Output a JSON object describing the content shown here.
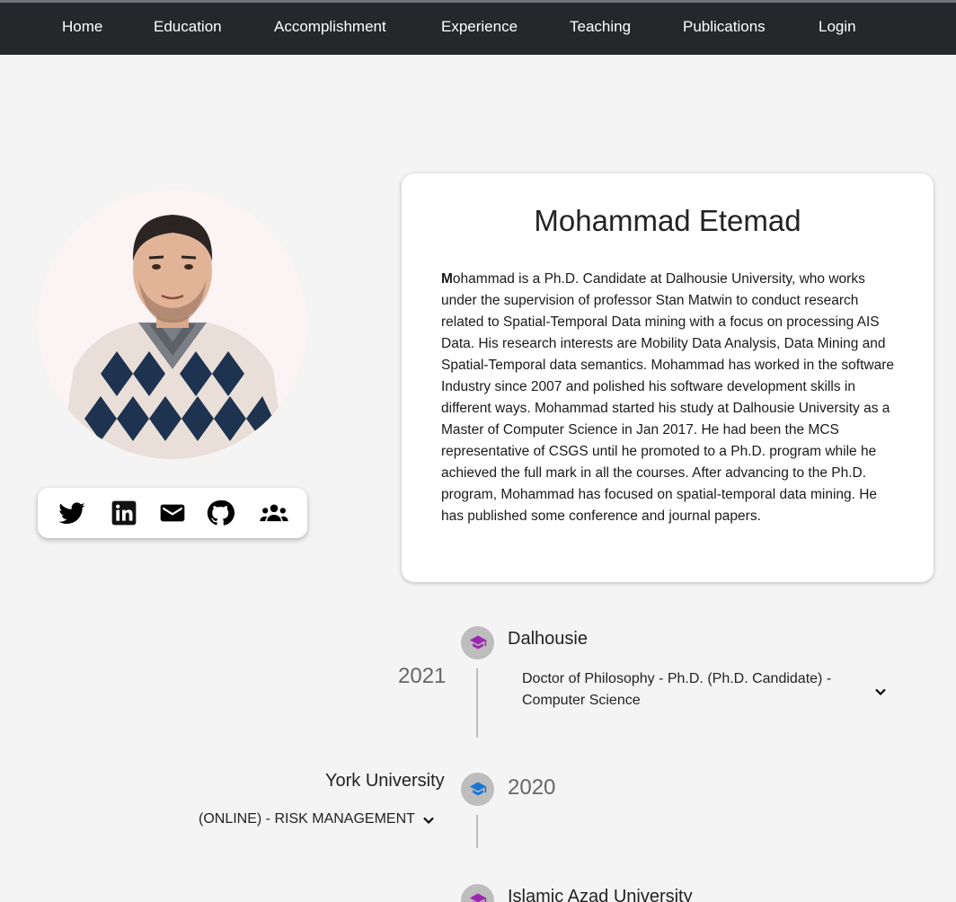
{
  "nav": {
    "items": [
      {
        "label": "Home"
      },
      {
        "label": "Education"
      },
      {
        "label": "Accomplishment"
      },
      {
        "label": "Experience"
      },
      {
        "label": "Teaching"
      },
      {
        "label": "Publications"
      },
      {
        "label": "Login"
      }
    ]
  },
  "profile": {
    "name": "Mohammad Etemad",
    "bio_first_letter": "M",
    "bio_rest": "ohammad is a Ph.D. Candidate at Dalhousie University, who works under the supervision of professor Stan Matwin to conduct research related to Spatial-Temporal Data mining with a focus on processing AIS Data. His research interests are Mobility Data Analysis, Data Mining and Spatial-Temporal data semantics. Mohammad has worked in the software Industry since 2007 and polished his software development skills in different ways. Mohammad started his study at Dalhousie University as a Master of Computer Science in Jan 2017. He had been the MCS representative of CSGS until he promoted to a Ph.D. program while he achieved the full mark in all the courses. After advancing to the Ph.D. program, Mohammad has focused on spatial-temporal data mining. He has published some conference and journal papers."
  },
  "social": {
    "icons": [
      "twitter-icon",
      "linkedin-icon",
      "email-icon",
      "github-icon",
      "group-icon"
    ]
  },
  "education": [
    {
      "year": "2021",
      "school": "Dalhousie",
      "degree": "Doctor of Philosophy - Ph.D. (Ph.D. Candidate) - Computer Science",
      "icon_color": "#9c27b0"
    },
    {
      "year": "2020",
      "school": "York University",
      "degree": "(ONLINE) - RISK MANAGEMENT",
      "icon_color": "#1976d2"
    },
    {
      "school": "Islamic Azad University",
      "icon_color": "#9c27b0"
    }
  ]
}
